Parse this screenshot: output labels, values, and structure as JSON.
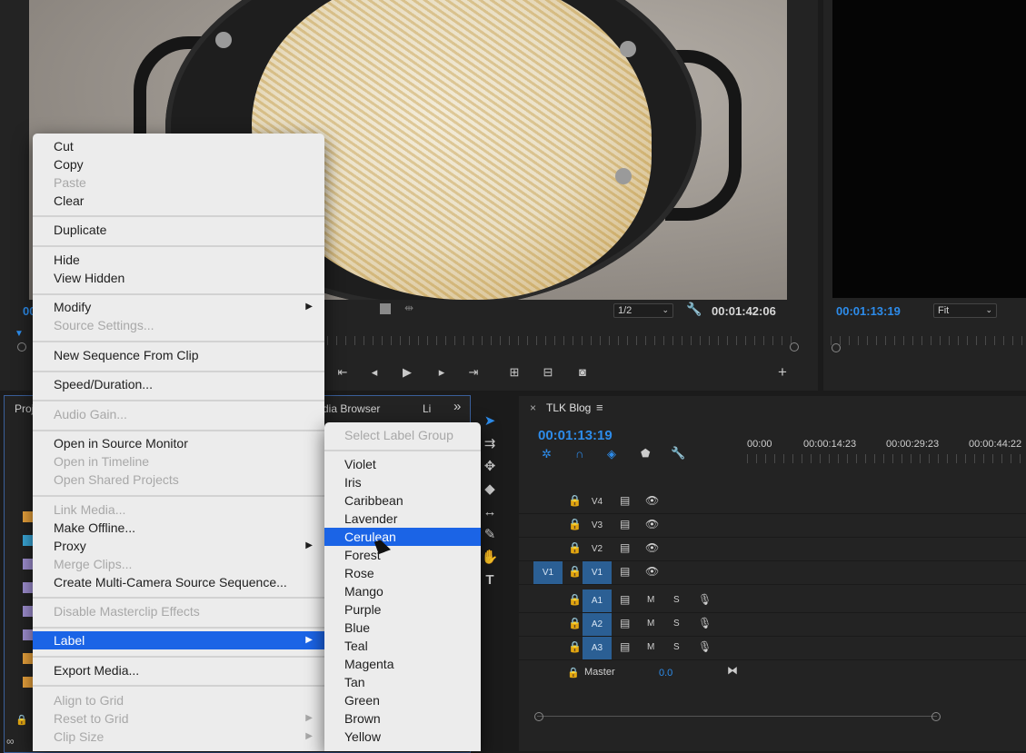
{
  "source": {
    "timecode_left": "00",
    "zoom": "1/2",
    "duration": "00:01:42:06"
  },
  "program": {
    "timecode": "00:01:13:19",
    "fit": "Fit"
  },
  "panel_tabs": {
    "project": "Proj",
    "media_browser": "dia Browser",
    "libraries": "Li",
    "overflow": "»"
  },
  "timeline": {
    "tab": "TLK Blog",
    "timecode": "00:01:13:19",
    "ruler": [
      "00:00",
      "00:00:14:23",
      "00:00:29:23",
      "00:00:44:22"
    ],
    "video_tracks": [
      {
        "name": "V4"
      },
      {
        "name": "V3"
      },
      {
        "name": "V2"
      },
      {
        "name": "V1",
        "source": "V1"
      }
    ],
    "audio_tracks": [
      {
        "name": "A1",
        "m": "M",
        "s": "S"
      },
      {
        "name": "A2",
        "m": "M",
        "s": "S"
      },
      {
        "name": "A3",
        "m": "M",
        "s": "S"
      }
    ],
    "master_label": "Master",
    "master_value": "0.0"
  },
  "context_menu": {
    "items": [
      {
        "label": "Cut"
      },
      {
        "label": "Copy"
      },
      {
        "label": "Paste"
      },
      {
        "label": "Clear"
      },
      {
        "label": "Duplicate"
      },
      {
        "label": "Hide"
      },
      {
        "label": "View Hidden"
      },
      {
        "label": "Modify"
      },
      {
        "label": "Source Settings..."
      },
      {
        "label": "New Sequence From Clip"
      },
      {
        "label": "Speed/Duration..."
      },
      {
        "label": "Audio Gain..."
      },
      {
        "label": "Open in Source Monitor"
      },
      {
        "label": "Open in Timeline"
      },
      {
        "label": "Open Shared Projects"
      },
      {
        "label": "Link Media..."
      },
      {
        "label": "Make Offline..."
      },
      {
        "label": "Proxy"
      },
      {
        "label": "Merge Clips..."
      },
      {
        "label": "Create Multi-Camera Source Sequence..."
      },
      {
        "label": "Disable Masterclip Effects"
      },
      {
        "label": "Label"
      },
      {
        "label": "Export Media..."
      },
      {
        "label": "Align to Grid"
      },
      {
        "label": "Reset to Grid"
      },
      {
        "label": "Clip Size"
      }
    ]
  },
  "label_submenu": {
    "header": "Select Label Group",
    "items": [
      "Violet",
      "Iris",
      "Caribbean",
      "Lavender",
      "Cerulean",
      "Forest",
      "Rose",
      "Mango",
      "Purple",
      "Blue",
      "Teal",
      "Magenta",
      "Tan",
      "Green",
      "Brown",
      "Yellow"
    ],
    "selected": "Cerulean"
  },
  "colors": {
    "accent": "#1b64e6",
    "timecode": "#2d8ceb",
    "track_active": "#2b5f94",
    "swatches": [
      "#e8a23c",
      "#3aa7d8",
      "#9f8fd1",
      "#9f8fd1",
      "#9f8fd1",
      "#9f8fd1",
      "#e8a23c",
      "#e8a23c"
    ]
  }
}
